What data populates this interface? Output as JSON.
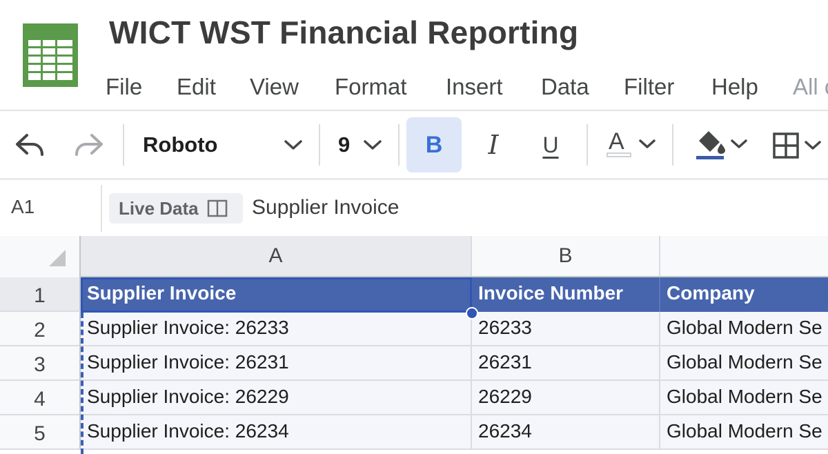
{
  "header": {
    "title": "WICT WST Financial Reporting",
    "logo_icon": "spreadsheet-logo-icon",
    "menu": [
      {
        "label": "File"
      },
      {
        "label": "Edit"
      },
      {
        "label": "View"
      },
      {
        "label": "Format"
      },
      {
        "label": "Insert"
      },
      {
        "label": "Data"
      },
      {
        "label": "Filter"
      },
      {
        "label": "Help"
      },
      {
        "label": "All c"
      }
    ]
  },
  "toolbar": {
    "undo_icon": "undo-icon",
    "redo_icon": "redo-icon",
    "font_family": "Roboto",
    "font_size": "9",
    "bold_label": "B",
    "italic_label": "I",
    "underline_label": "U",
    "text_color_icon": "text-color-icon",
    "fill_color_icon": "fill-color-icon",
    "borders_icon": "borders-icon",
    "bold_active": true
  },
  "formula_bar": {
    "cell_ref": "A1",
    "live_data_label": "Live Data",
    "value": "Supplier Invoice"
  },
  "grid": {
    "columns": [
      "A",
      "B",
      ""
    ],
    "rows": [
      "1",
      "2",
      "3",
      "4",
      "5"
    ],
    "header": [
      "Supplier Invoice",
      "Invoice Number",
      "Company"
    ],
    "data": [
      [
        "Supplier Invoice: 26233",
        "26233",
        "Global Modern Se"
      ],
      [
        "Supplier Invoice: 26231",
        "26231",
        "Global Modern Se"
      ],
      [
        "Supplier Invoice: 26229",
        "26229",
        "Global Modern Se"
      ],
      [
        "Supplier Invoice: 26234",
        "26234",
        "Global Modern Se"
      ]
    ],
    "selected_cell": "A1"
  },
  "colors": {
    "header_fill": "#4765ad",
    "selection": "#2f55b5",
    "logo_green": "#2e8b3a"
  }
}
